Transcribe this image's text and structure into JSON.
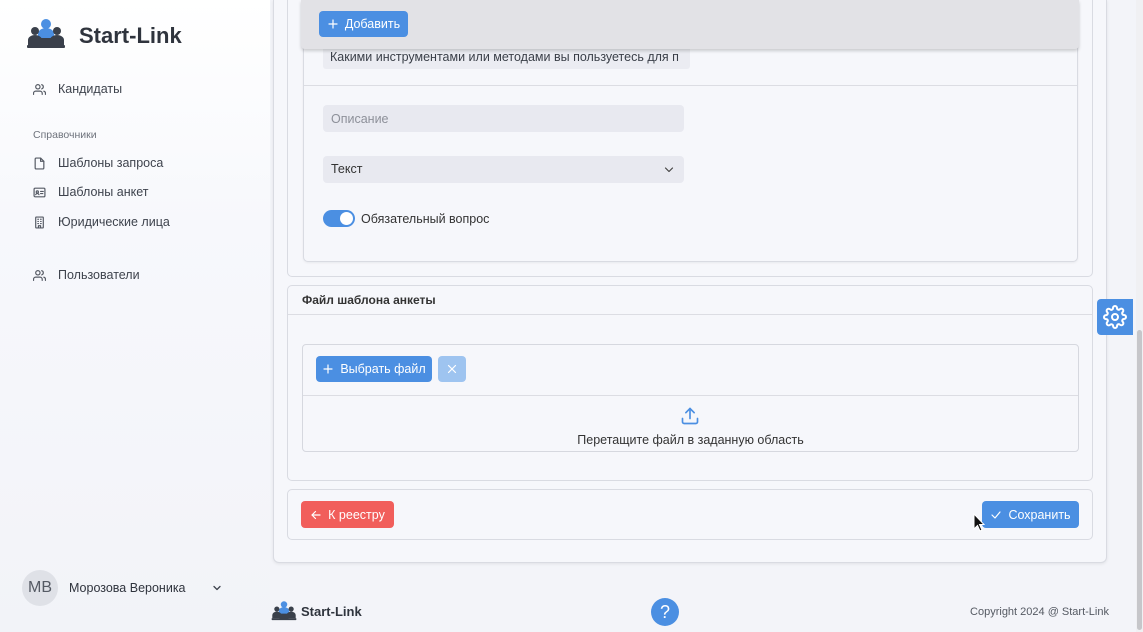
{
  "app": {
    "name": "Start-Link"
  },
  "sidebar": {
    "items": [
      {
        "label": "Кандидаты",
        "icon": "users-icon"
      }
    ],
    "section_title": "Справочники",
    "reference_items": [
      {
        "label": "Шаблоны запроса",
        "icon": "file-icon"
      },
      {
        "label": "Шаблоны анкет",
        "icon": "id-card-icon"
      },
      {
        "label": "Юридические лица",
        "icon": "building-icon"
      }
    ],
    "admin_items": [
      {
        "label": "Пользователи",
        "icon": "users-icon"
      }
    ],
    "user": {
      "initials": "МВ",
      "name": "Морозова Вероника",
      "menu_icon": "chevron-down-icon"
    }
  },
  "question_editor": {
    "add_button": {
      "label": "Добавить",
      "icon": "plus-icon"
    },
    "question_text": "Какими инструментами или методами вы пользуетесь для п",
    "description_placeholder": "Описание",
    "answer_type": {
      "value": "Текст",
      "icon": "chevron-down-icon"
    },
    "required": {
      "label": "Обязательный вопрос",
      "checked": true
    }
  },
  "template_file": {
    "title": "Файл шаблона анкеты",
    "choose_button": {
      "label": "Выбрать файл",
      "icon": "plus-icon"
    },
    "clear_button": {
      "icon": "close-icon",
      "disabled": true
    },
    "drop_icon": "upload-icon",
    "drop_hint": "Перетащите файл в заданную область"
  },
  "actions": {
    "back_button": {
      "label": "К реестру",
      "icon": "arrow-left-icon"
    },
    "save_button": {
      "label": "Сохранить",
      "icon": "check-icon"
    }
  },
  "floating": {
    "settings_icon": "gear-icon"
  },
  "footer": {
    "brand": "Start-Link",
    "help_label": "?",
    "copyright": "Copyright 2024 @ Start-Link"
  },
  "colors": {
    "primary": "#4b8fe2",
    "primary_disabled": "#9ec4f0",
    "danger": "#f15e5b",
    "background": "#f3f4f9",
    "input": "#e8e9f0",
    "text": "#333333"
  }
}
